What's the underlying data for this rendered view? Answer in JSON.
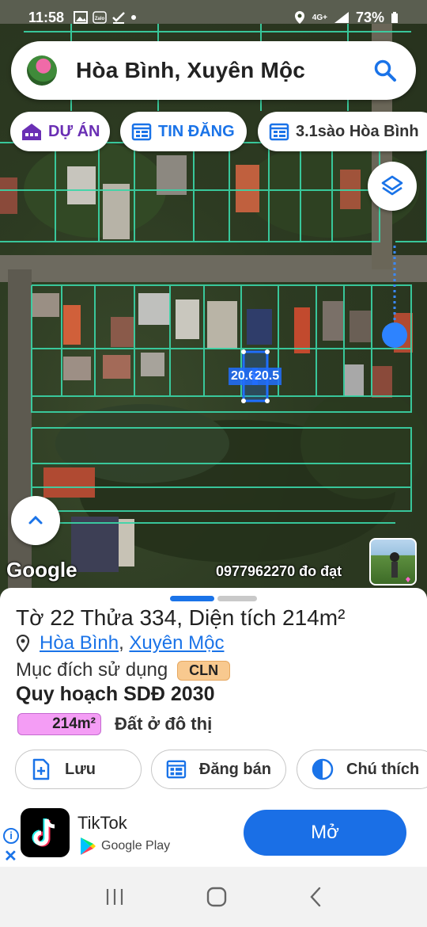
{
  "status": {
    "time": "11:58",
    "network": "4G+",
    "battery": "73%"
  },
  "search": {
    "title": "Hòa Bình, Xuyên Mộc"
  },
  "chips": [
    {
      "label": "DỰ ÁN",
      "icon": "building-icon"
    },
    {
      "label": "TIN ĐĂNG",
      "icon": "listing-icon"
    },
    {
      "label": "3.1sào Hòa Bình",
      "icon": "listing-icon"
    }
  ],
  "map": {
    "dim_left": "20.6",
    "dim_right": "20.5",
    "attribution": "Google",
    "overlay_text": "0977962270 đo đạt"
  },
  "parcel": {
    "sheet_label": "Tờ",
    "sheet_no": "22",
    "lot_label": "Thửa",
    "lot_no": "334",
    "area_label": "Diện tích",
    "area": "214m²",
    "commune": "Hòa Bình",
    "district": "Xuyên Mộc",
    "purpose_label": "Mục đích sử dụng",
    "purpose_code": "CLN",
    "plan_title": "Quy hoạch SDĐ 2030",
    "plan_area": "214m²",
    "plan_zone": "Đất ở đô thị",
    "colors": {
      "plan_badge": "#f49df5",
      "purpose_badge": "#f8c98f"
    }
  },
  "actions": [
    {
      "label": "Lưu",
      "icon": "add-document-icon"
    },
    {
      "label": "Đăng bán",
      "icon": "calendar-list-icon"
    },
    {
      "label": "Chú thích",
      "icon": "half-circle-icon"
    }
  ],
  "ad": {
    "app": "TikTok",
    "store": "Google Play",
    "cta": "Mở"
  }
}
